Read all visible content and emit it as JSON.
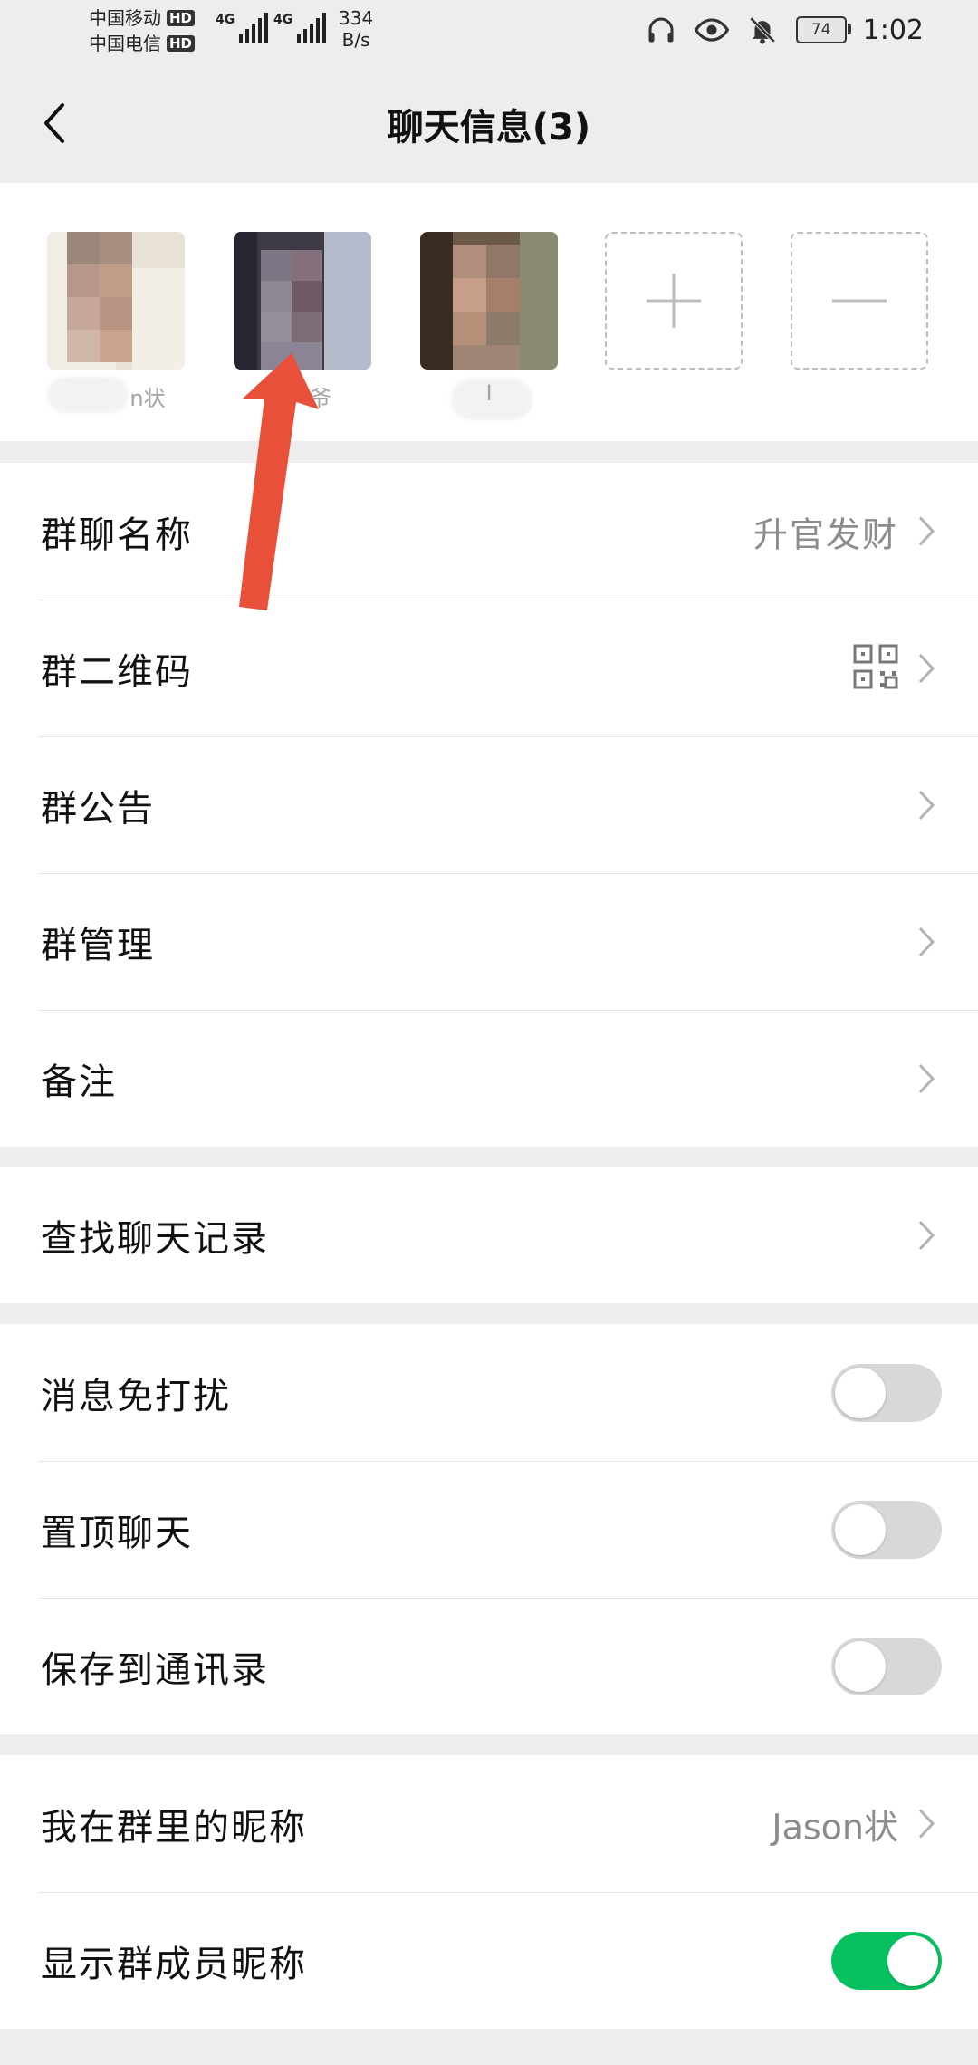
{
  "status_bar": {
    "carrier1": "中国移动",
    "carrier2": "中国电信",
    "hd": "HD",
    "network": "4G",
    "speed_value": "334",
    "speed_unit": "B/s",
    "battery": "74",
    "time": "1:02"
  },
  "header": {
    "title": "聊天信息(3)"
  },
  "members": [
    {
      "name": "n状"
    },
    {
      "name": "爷"
    },
    {
      "name": "I"
    }
  ],
  "settings": {
    "group_name_label": "群聊名称",
    "group_name_value": "升官发财",
    "group_qr_label": "群二维码",
    "announcement_label": "群公告",
    "management_label": "群管理",
    "remark_label": "备注",
    "search_history_label": "查找聊天记录",
    "mute_label": "消息免打扰",
    "mute_on": false,
    "sticky_label": "置顶聊天",
    "sticky_on": false,
    "save_contacts_label": "保存到通讯录",
    "save_contacts_on": false,
    "my_nickname_label": "我在群里的昵称",
    "my_nickname_value": "Jason状",
    "show_nicknames_label": "显示群成员昵称",
    "show_nicknames_on": true
  },
  "colors": {
    "accent_green": "#07c160",
    "annotation_arrow": "#e8503a"
  }
}
